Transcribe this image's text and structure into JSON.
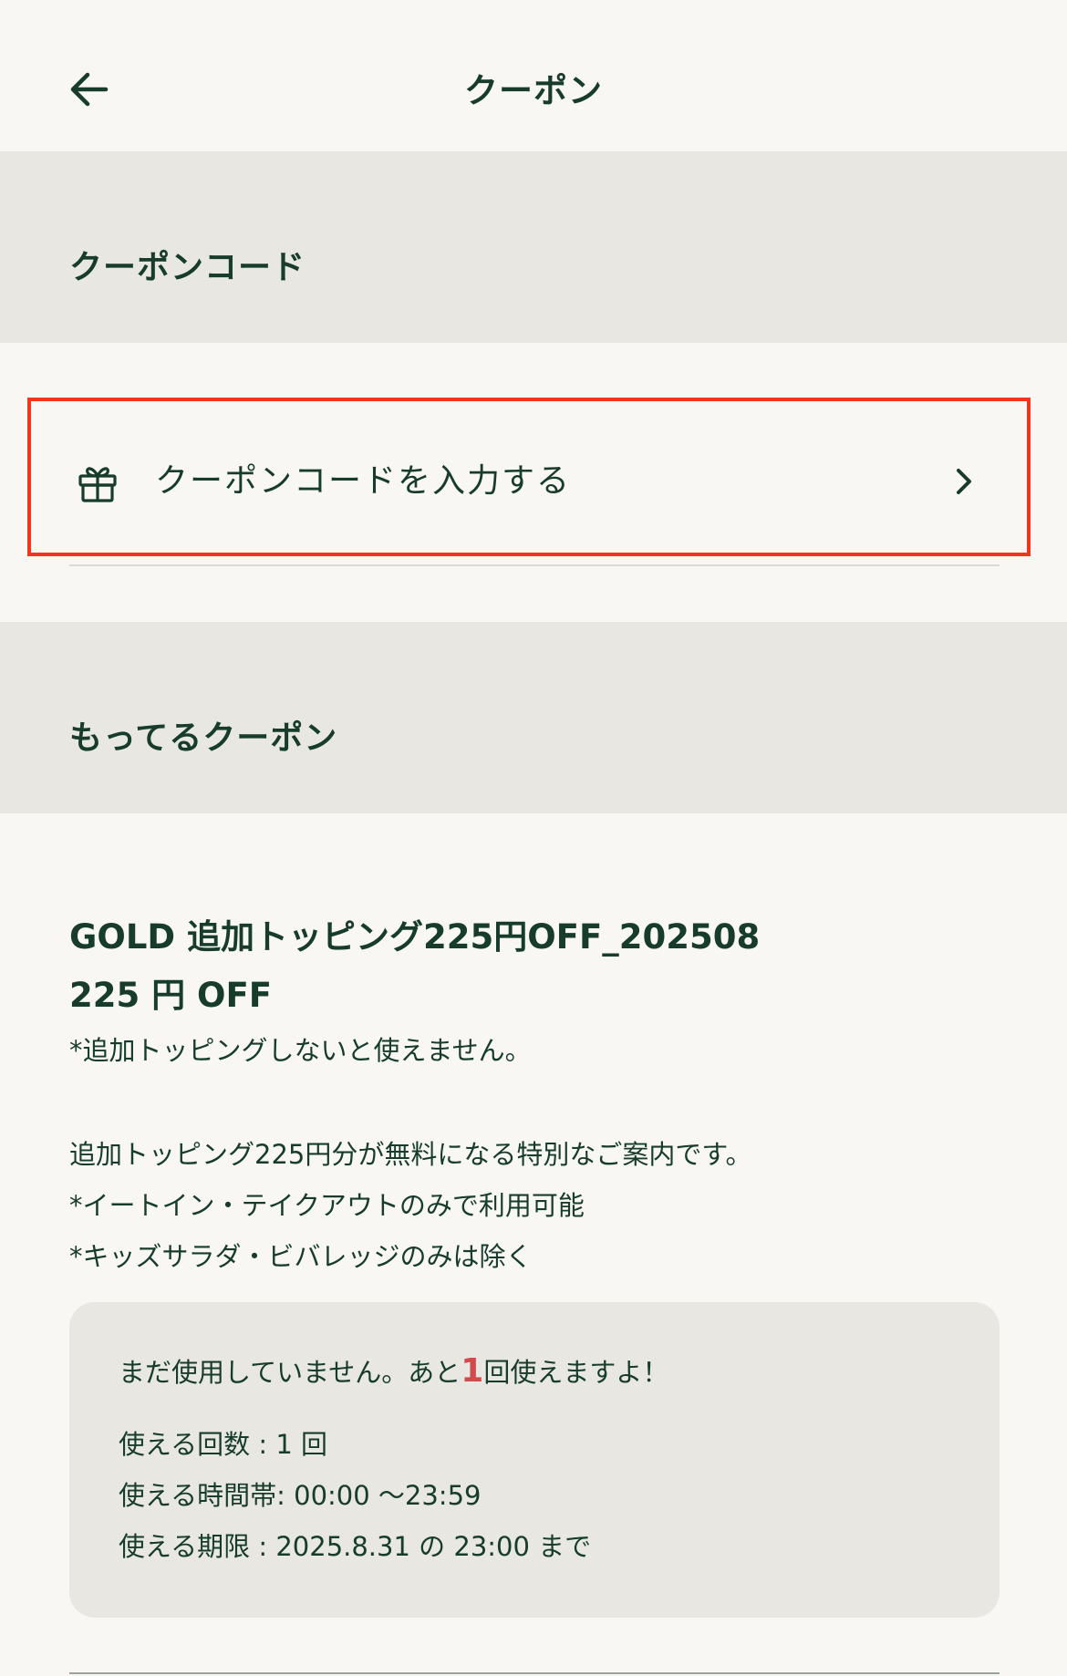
{
  "header": {
    "title": "クーポン",
    "back_icon": "arrow-left-icon"
  },
  "coupon_code_section": {
    "title": "クーポンコード",
    "enter_label": "クーポンコードを入力する",
    "gift_icon": "gift-icon",
    "chevron_icon": "chevron-right-icon"
  },
  "owned_section": {
    "title": "もってるクーポン"
  },
  "coupon": {
    "name": "GOLD 追加トッピング225円OFF_202508",
    "discount": "225 円 OFF",
    "note": "*追加トッピングしないと使えません。",
    "desc_1": "追加トッピング225円分が無料になる特別なご案内です。",
    "desc_2": "*イートイン・テイクアウトのみで利用可能",
    "desc_3": "*キッズサラダ・ビバレッジのみは除く",
    "status_prefix": "まだ使用していません。あと",
    "status_count": "1",
    "status_suffix": "回使えますよ！",
    "usage_count": "使える回数 : 1 回",
    "usage_hours": "使える時間帯: 00:00 〜23:59",
    "expiry": "使える期限 : 2025.8.31 の 23:00 まで"
  },
  "colors": {
    "background": "#f8f7f3",
    "section_bg": "#e8e7e2",
    "text": "#173c2c",
    "highlight_border": "#f2351c",
    "count_accent": "#d24b4b"
  }
}
